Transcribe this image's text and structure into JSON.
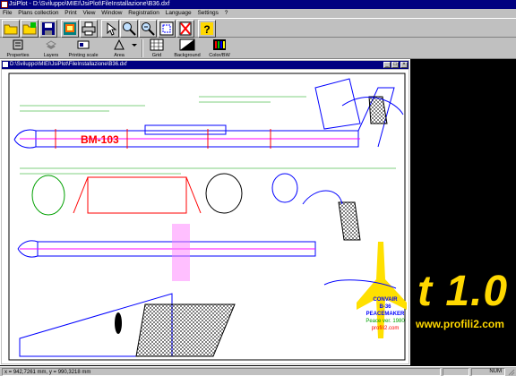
{
  "window": {
    "title": "JsiPlot - D:\\Sviluppo\\MIEI\\JsiPlot\\FileInstallazione\\B36.dxf"
  },
  "menu": [
    "File",
    "Plans collection",
    "Print",
    "View",
    "Window",
    "Registration",
    "Language",
    "Settings",
    "?"
  ],
  "toolbar_icons": [
    "open-folder-icon",
    "open-plans-icon",
    "save-disk-icon",
    "plotter-icon",
    "printer-icon",
    "pointer-icon",
    "zoom-in-icon",
    "zoom-out-icon",
    "zoom-window-icon",
    "close-doc-icon",
    "help-icon"
  ],
  "toolbar2": {
    "properties": "Properties",
    "layers": "Layers",
    "printing_scale": "Printing scale",
    "area": "Area",
    "grid": "Grid",
    "background": "Background",
    "color_bw": "Color/BW"
  },
  "document": {
    "title": "D:\\Sviluppo\\MIEI\\JsiPlot\\FileInstallazione\\B36.dxf",
    "fuselage_label": "BM-103",
    "plan_title_lines": [
      "CONVAIR",
      "B-36",
      "PEACEMAKER",
      "Peace ver. 1980",
      "profili2.com"
    ]
  },
  "splash": {
    "version_text": "t 1.0",
    "url": "www.profili2.com"
  },
  "status": {
    "coords": "x = 942,7261 mm, y = 990,3218 mm",
    "panel": "NUM"
  },
  "colors": {
    "title_bar": "#000080",
    "splash": "#ffd800",
    "fuselage": "#ff0000",
    "outline": "#0000ff",
    "highlight": "#ff00ff"
  }
}
